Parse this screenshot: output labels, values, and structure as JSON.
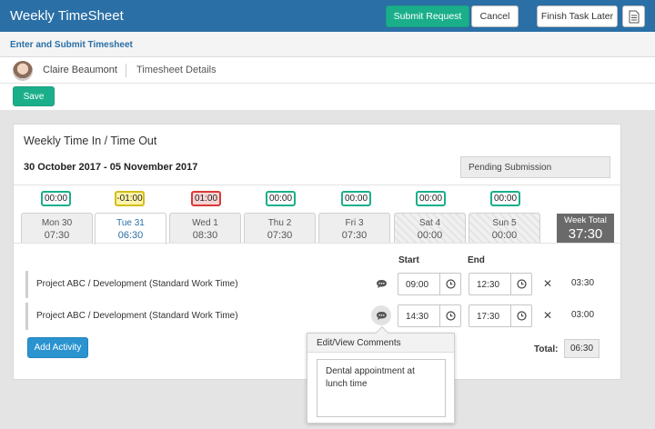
{
  "header": {
    "title": "Weekly TimeSheet",
    "submit_label": "Submit Request",
    "cancel_label": "Cancel",
    "finish_label": "Finish Task Later",
    "doc_icon": "document-icon",
    "accent": "#2a6fa6"
  },
  "subheader": {
    "title": "Enter and Submit Timesheet"
  },
  "user": {
    "name": "Claire Beaumont",
    "crumb": "Timesheet Details"
  },
  "actions": {
    "save_label": "Save"
  },
  "card": {
    "title": "Weekly Time In / Time Out",
    "date_range": "30 October 2017 - 05 November 2017",
    "status": "Pending Submission"
  },
  "diffs": [
    "00:00",
    "-01:00",
    "01:00",
    "00:00",
    "00:00",
    "00:00",
    "00:00"
  ],
  "days": [
    {
      "label": "Mon 30",
      "hours": "07:30"
    },
    {
      "label": "Tue 31",
      "hours": "06:30"
    },
    {
      "label": "Wed 1",
      "hours": "08:30"
    },
    {
      "label": "Thu 2",
      "hours": "07:30"
    },
    {
      "label": "Fri 3",
      "hours": "07:30"
    },
    {
      "label": "Sat 4",
      "hours": "00:00"
    },
    {
      "label": "Sun 5",
      "hours": "00:00"
    }
  ],
  "week_total": {
    "label": "Week Total",
    "value": "37:30"
  },
  "columns": {
    "start": "Start",
    "end": "End"
  },
  "activities": [
    {
      "name": "Project ABC / Development (Standard Work Time)",
      "start": "09:00",
      "end": "12:30",
      "total": "03:30"
    },
    {
      "name": "Project ABC / Development (Standard Work Time)",
      "start": "14:30",
      "end": "17:30",
      "total": "03:00"
    }
  ],
  "footer": {
    "add_label": "Add Activity",
    "total_label": "Total:",
    "total_value": "06:30"
  },
  "popover": {
    "title": "Edit/View Comments",
    "comment": "Dental appointment at lunch time"
  },
  "colors": {
    "green": "#1aaf8a",
    "blue": "#2a93d0",
    "yellow": "#d4bd1c",
    "red": "#d93a3a"
  }
}
